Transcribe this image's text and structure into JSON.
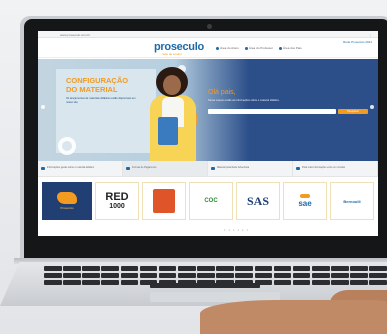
{
  "browser": {
    "address": "www.proseculo.com.br"
  },
  "header": {
    "logo": "proseculo",
    "logo_tagline": "rede de ensino",
    "nav_links": [
      "Área do Aluno",
      "Área do Professor",
      "Área dos Pais"
    ],
    "top_right": "Rede Proseculo 2021"
  },
  "hero": {
    "title_line1": "CONFIGURAÇÃO",
    "title_line2": "DO MATERIAL",
    "text": "Os lançamentos de materiais didáticos estão disponíveis em nosso site.",
    "greeting": "Olá pais,",
    "form_text": "Nesse espaço estão as informações sobre o material didático.",
    "button_label": "Pesquisar",
    "input_placeholder": ""
  },
  "info_items": [
    "Informações gerais sobre o material didático",
    "Formas de Pagamento",
    "Material para Rede Adventista",
    "Para mais informações entre em contato"
  ],
  "brands": {
    "first_label": "Proseculo",
    "red_line1": "RED",
    "red_line2": "1000",
    "coc": "COC",
    "sas": "SAS",
    "sae": "sae",
    "last": "Bernoulli"
  },
  "pager": "• • • • • •",
  "colors": {
    "brand_blue": "#1d6aa8",
    "accent_orange": "#f29b20",
    "hero_dark": "#2c4f8a"
  }
}
